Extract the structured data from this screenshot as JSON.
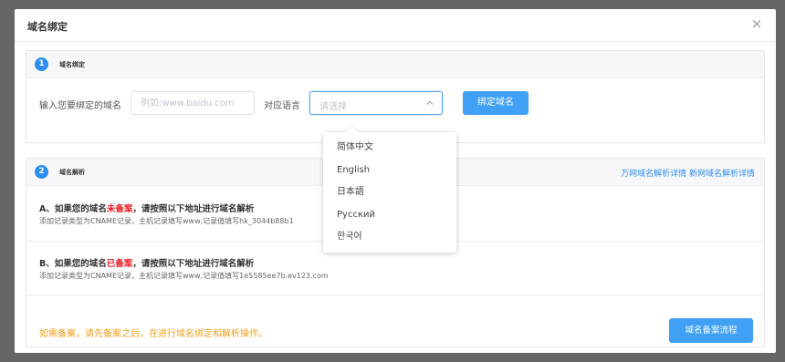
{
  "dialog": {
    "title": "域名绑定",
    "close_glyph": "×"
  },
  "step1": {
    "number": "1",
    "title": "域名绑定",
    "domain_label": "输入您要绑定的域名",
    "domain_placeholder": "例如:www.baidu.com",
    "lang_label": "对应语言",
    "lang_placeholder": "请选择",
    "bind_button": "绑定域名"
  },
  "language_options": [
    "简体中文",
    "English",
    "日本語",
    "Русский",
    "한국어"
  ],
  "step2": {
    "number": "2",
    "title": "域名解析",
    "link_wanwang": "万网域名解析详情",
    "link_xinwang": "新网域名解析详情",
    "section_a": {
      "title_prefix": "A、如果您的域名",
      "title_highlight": "未备案",
      "title_suffix": "，请按照以下地址进行域名解析",
      "description": "添加记录类型为CNAME记录，主机记录填写www,记录值填写hk_3044b88b1"
    },
    "section_b": {
      "title_prefix": "B、如果您的域名",
      "title_highlight": "已备案",
      "title_suffix": "，请按照以下地址进行域名解析",
      "description": "添加记录类型为CNAME记录，主机记录填写www,记录值填写1e5585ee7b.ev123.com"
    },
    "notice": "如需备案，请先备案之后，在进行域名绑定和解析操作。",
    "flow_button": "域名备案流程"
  },
  "colors": {
    "accent": "#3fa0f5",
    "link": "#2d8cf0",
    "warning": "#f0a020",
    "highlight": "#ed1c24"
  }
}
